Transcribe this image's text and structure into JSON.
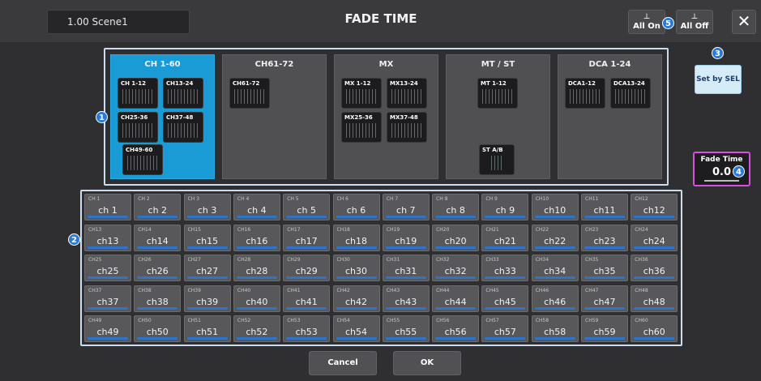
{
  "header": {
    "scene": "1.00  Scene1",
    "title": "FADE TIME",
    "all_on_label": "All On",
    "all_off_label": "All Off",
    "close_label": "✕"
  },
  "callouts": [
    "1",
    "2",
    "3",
    "4",
    "5"
  ],
  "groups": [
    {
      "name": "CH 1-60",
      "active": true,
      "blocks": [
        "CH 1-12",
        "CH13-24",
        "CH25-36",
        "CH37-48",
        "CH49-60"
      ]
    },
    {
      "name": "CH61-72",
      "active": false,
      "blocks": [
        "CH61-72"
      ]
    },
    {
      "name": "MX",
      "active": false,
      "blocks": [
        "MX 1-12",
        "MX13-24",
        "MX25-36",
        "MX37-48"
      ]
    },
    {
      "name": "MT / ST",
      "active": false,
      "blocks": [
        "MT 1-12",
        "ST A/B"
      ]
    },
    {
      "name": "DCA 1-24",
      "active": false,
      "blocks": [
        "DCA1-12",
        "DCA13-24"
      ]
    }
  ],
  "set_by_sel_label": "Set by SEL",
  "fade_time": {
    "label": "Fade Time",
    "value": "0.0"
  },
  "channels": [
    {
      "short": "CH 1",
      "name": "ch 1"
    },
    {
      "short": "CH 2",
      "name": "ch 2"
    },
    {
      "short": "CH 3",
      "name": "ch 3"
    },
    {
      "short": "CH 4",
      "name": "ch 4"
    },
    {
      "short": "CH 5",
      "name": "ch 5"
    },
    {
      "short": "CH 6",
      "name": "ch 6"
    },
    {
      "short": "CH 7",
      "name": "ch 7"
    },
    {
      "short": "CH 8",
      "name": "ch 8"
    },
    {
      "short": "CH 9",
      "name": "ch 9"
    },
    {
      "short": "CH10",
      "name": "ch10"
    },
    {
      "short": "CH11",
      "name": "ch11"
    },
    {
      "short": "CH12",
      "name": "ch12"
    },
    {
      "short": "CH13",
      "name": "ch13"
    },
    {
      "short": "CH14",
      "name": "ch14"
    },
    {
      "short": "CH15",
      "name": "ch15"
    },
    {
      "short": "CH16",
      "name": "ch16"
    },
    {
      "short": "CH17",
      "name": "ch17"
    },
    {
      "short": "CH18",
      "name": "ch18"
    },
    {
      "short": "CH19",
      "name": "ch19"
    },
    {
      "short": "CH20",
      "name": "ch20"
    },
    {
      "short": "CH21",
      "name": "ch21"
    },
    {
      "short": "CH22",
      "name": "ch22"
    },
    {
      "short": "CH23",
      "name": "ch23"
    },
    {
      "short": "CH24",
      "name": "ch24"
    },
    {
      "short": "CH25",
      "name": "ch25"
    },
    {
      "short": "CH26",
      "name": "ch26"
    },
    {
      "short": "CH27",
      "name": "ch27"
    },
    {
      "short": "CH28",
      "name": "ch28"
    },
    {
      "short": "CH29",
      "name": "ch29"
    },
    {
      "short": "CH30",
      "name": "ch30"
    },
    {
      "short": "CH31",
      "name": "ch31"
    },
    {
      "short": "CH32",
      "name": "ch32"
    },
    {
      "short": "CH33",
      "name": "ch33"
    },
    {
      "short": "CH34",
      "name": "ch34"
    },
    {
      "short": "CH35",
      "name": "ch35"
    },
    {
      "short": "CH36",
      "name": "ch36"
    },
    {
      "short": "CH37",
      "name": "ch37"
    },
    {
      "short": "CH38",
      "name": "ch38"
    },
    {
      "short": "CH39",
      "name": "ch39"
    },
    {
      "short": "CH40",
      "name": "ch40"
    },
    {
      "short": "CH41",
      "name": "ch41"
    },
    {
      "short": "CH42",
      "name": "ch42"
    },
    {
      "short": "CH43",
      "name": "ch43"
    },
    {
      "short": "CH44",
      "name": "ch44"
    },
    {
      "short": "CH45",
      "name": "ch45"
    },
    {
      "short": "CH46",
      "name": "ch46"
    },
    {
      "short": "CH47",
      "name": "ch47"
    },
    {
      "short": "CH48",
      "name": "ch48"
    },
    {
      "short": "CH49",
      "name": "ch49"
    },
    {
      "short": "CH50",
      "name": "ch50"
    },
    {
      "short": "CH51",
      "name": "ch51"
    },
    {
      "short": "CH52",
      "name": "ch52"
    },
    {
      "short": "CH53",
      "name": "ch53"
    },
    {
      "short": "CH54",
      "name": "ch54"
    },
    {
      "short": "CH55",
      "name": "ch55"
    },
    {
      "short": "CH56",
      "name": "ch56"
    },
    {
      "short": "CH57",
      "name": "ch57"
    },
    {
      "short": "CH58",
      "name": "ch58"
    },
    {
      "short": "CH59",
      "name": "ch59"
    },
    {
      "short": "CH60",
      "name": "ch60"
    }
  ],
  "footer": {
    "cancel_label": "Cancel",
    "ok_label": "OK"
  },
  "colors": {
    "active_group": "#1a9bd6",
    "channel_bar": "#2e74c8",
    "callout": "#2a7ad8",
    "fade_time_border": "#d84fe0"
  }
}
